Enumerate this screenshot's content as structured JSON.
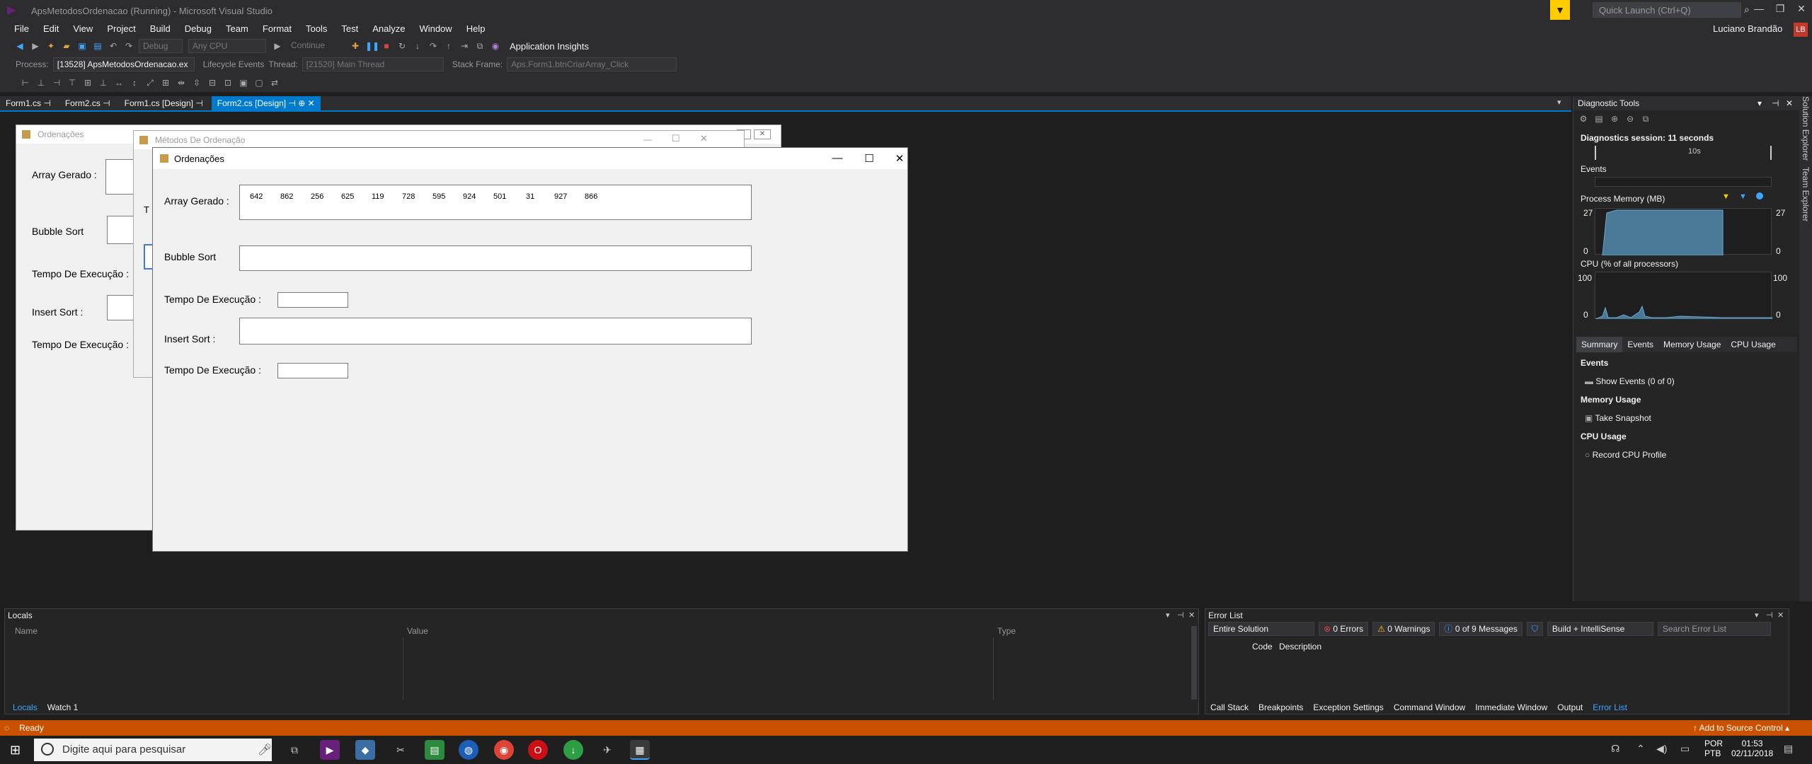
{
  "window": {
    "title": "ApsMetodosOrdenacao (Running) - Microsoft Visual Studio",
    "quick_launch_placeholder": "Quick Launch (Ctrl+Q)",
    "user": "Luciano Brandão",
    "user_initials": "LB"
  },
  "menu": [
    "File",
    "Edit",
    "View",
    "Project",
    "Build",
    "Debug",
    "Team",
    "Format",
    "Tools",
    "Test",
    "Analyze",
    "Window",
    "Help"
  ],
  "toolbar": {
    "config": "Debug",
    "platform": "Any CPU",
    "continue_label": "Continue",
    "app_insights": "Application Insights"
  },
  "debugbar": {
    "process_label": "Process:",
    "process_value": "[13528] ApsMetodosOrdenacao.ex",
    "lifecycle_label": "Lifecycle Events",
    "thread_label": "Thread:",
    "thread_value": "[21520] Main Thread",
    "stack_label": "Stack Frame:",
    "stack_value": "Aps.Form1.btnCriarArray_Click"
  },
  "tabs": [
    "Form1.cs",
    "Form2.cs",
    "Form1.cs [Design]",
    "Form2.cs [Design]"
  ],
  "design1": {
    "title": "Ordenações",
    "labels": [
      "Array Gerado :",
      "Bubble Sort",
      "Tempo De Execução :",
      "Insert Sort :",
      "Tempo De Execução :"
    ]
  },
  "design2": {
    "title": "Métodos De Ordenação",
    "t_label": "T"
  },
  "runform": {
    "title": "Ordenações",
    "array_label": "Array Gerado :",
    "array_values": [
      "642",
      "862",
      "256",
      "625",
      "119",
      "728",
      "595",
      "924",
      "501",
      "31",
      "927",
      "866"
    ],
    "bubble_label": "Bubble Sort",
    "tempo1_label": "Tempo De Execução :",
    "insert_label": "Insert Sort :",
    "tempo2_label": "Tempo De Execução :"
  },
  "diag": {
    "title": "Diagnostic Tools",
    "session": "Diagnostics session: 11 seconds",
    "timeline_tick": "10s",
    "events": "Events",
    "memory_title": "Process Memory (MB)",
    "mem_max": "27",
    "mem_min": "0",
    "cpu_title": "CPU (% of all processors)",
    "cpu_max": "100",
    "cpu_min": "0",
    "tabs": [
      "Summary",
      "Events",
      "Memory Usage",
      "CPU Usage"
    ],
    "sections": {
      "events_h": "Events",
      "show_events": "Show Events (0 of 0)",
      "memory_h": "Memory Usage",
      "snapshot": "Take Snapshot",
      "cpu_h": "CPU Usage",
      "record": "Record CPU Profile"
    }
  },
  "side_tabs": [
    "Solution Explorer",
    "Team Explorer"
  ],
  "locals": {
    "title": "Locals",
    "columns": [
      "Name",
      "Value",
      "Type"
    ],
    "tabs": [
      "Locals",
      "Watch 1"
    ]
  },
  "errlist": {
    "title": "Error List",
    "scope": "Entire Solution",
    "errors": "0 Errors",
    "warnings": "0 Warnings",
    "messages": "0 of 9 Messages",
    "build": "Build + IntelliSense",
    "search_placeholder": "Search Error List",
    "columns": [
      "Code",
      "Description"
    ],
    "tabs": [
      "Call Stack",
      "Breakpoints",
      "Exception Settings",
      "Command Window",
      "Immediate Window",
      "Output",
      "Error List"
    ]
  },
  "status": {
    "text": "Ready",
    "source_control": "Add to Source Control"
  },
  "taskbar": {
    "search_placeholder": "Digite aqui para pesquisar",
    "lang1": "POR",
    "lang2": "PTB",
    "time": "01:53",
    "date": "02/11/2018"
  }
}
